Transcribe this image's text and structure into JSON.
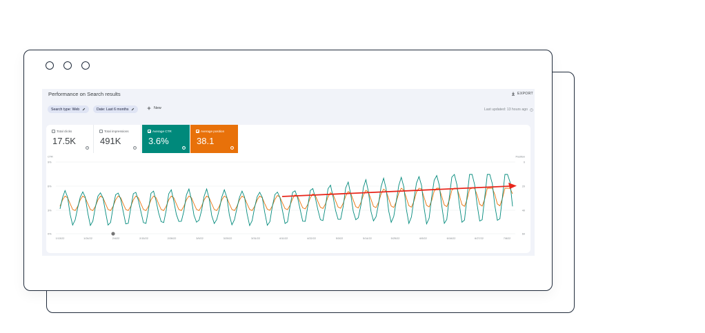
{
  "window": {
    "title_dots": 3
  },
  "header": {
    "title": "Performance on Search results",
    "export_label": "EXPORT"
  },
  "filters": {
    "search_type": "Search type: Web",
    "date": "Date: Last 6 months",
    "new_label": "New",
    "last_updated": "Last updated: 13 hours ago"
  },
  "metrics": [
    {
      "label": "Total clicks",
      "value": "17.5K",
      "selected": false
    },
    {
      "label": "Total impressions",
      "value": "491K",
      "selected": false
    },
    {
      "label": "Average CTR",
      "value": "3.6%",
      "selected": true,
      "color": "#00897b"
    },
    {
      "label": "Average position",
      "value": "38.1",
      "selected": true,
      "color": "#e8710a"
    }
  ],
  "chart_data": {
    "type": "line",
    "x_tick_labels": [
      "1/13/22",
      "1/24/22",
      "2/4/22",
      "2/15/22",
      "2/26/22",
      "3/9/22",
      "3/20/22",
      "3/31/22",
      "4/11/22",
      "4/22/22",
      "5/3/22",
      "5/14/22",
      "5/25/22",
      "6/5/22",
      "6/16/22",
      "6/27/22",
      "7/8/22"
    ],
    "left_axis": {
      "label": "CTR",
      "ticks": [
        "9%",
        "6%",
        "3%",
        "0%"
      ]
    },
    "right_axis": {
      "label": "Position",
      "ticks": [
        "0",
        "20",
        "40",
        "60"
      ]
    },
    "series": [
      {
        "name": "Average CTR",
        "color": "#00897b"
      },
      {
        "name": "Average position",
        "color": "#e8710a"
      }
    ],
    "annotation": {
      "type": "trend-arrow",
      "color": "#e8261b"
    }
  }
}
